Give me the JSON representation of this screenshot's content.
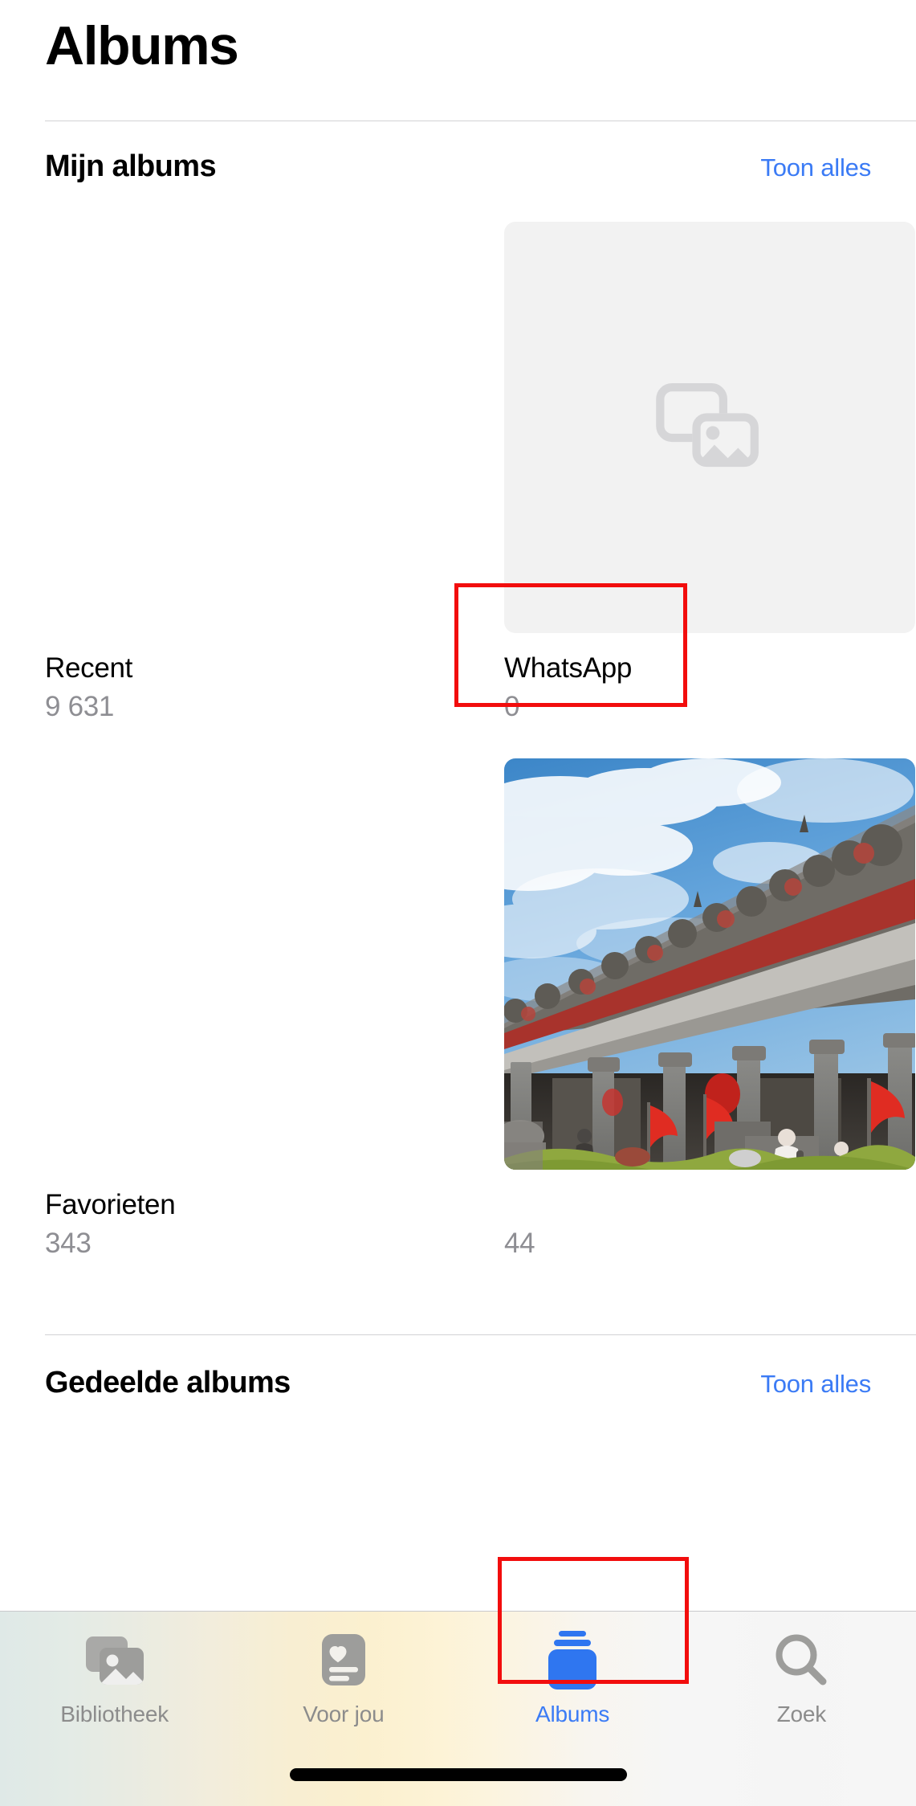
{
  "app": {
    "nav_title": "Albums"
  },
  "sections": [
    {
      "id": "my-albums",
      "title": "Mijn albums",
      "action_label": "Toon alles"
    },
    {
      "id": "shared-albums",
      "title": "Gedeelde albums",
      "action_label": "Toon alles"
    }
  ],
  "albums": [
    {
      "name": "Recent",
      "count": "9 631",
      "thumb": "none"
    },
    {
      "name": "WhatsApp",
      "count": "0",
      "thumb": "placeholder",
      "thumb_icon": "photo-stack-icon",
      "highlighted": true
    },
    {
      "name": "Favorieten",
      "count": "343",
      "thumb": "none"
    },
    {
      "name": "",
      "count": "44",
      "thumb": "photo",
      "photo_description": "Chinese ancestral hall with blue sky and red flags"
    }
  ],
  "tabbar": {
    "items": [
      {
        "label": "Bibliotheek",
        "icon": "photo-stack-icon",
        "active": false
      },
      {
        "label": "Voor jou",
        "icon": "for-you-card-heart-icon",
        "active": false
      },
      {
        "label": "Albums",
        "icon": "albums-stack-icon",
        "active": true
      },
      {
        "label": "Zoek",
        "icon": "search-icon",
        "active": false
      }
    ]
  },
  "colors": {
    "accent": "#3b7bf5",
    "secondary_text": "#8e8e93",
    "tab_inactive": "#8c8c8c",
    "divider": "#d2d2d4",
    "placeholder_bg": "#f2f2f2",
    "highlight_box": "#f20d0d"
  }
}
